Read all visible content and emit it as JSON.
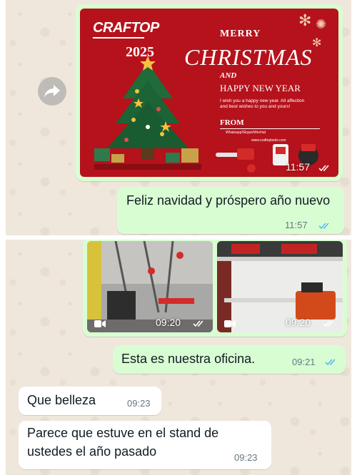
{
  "card": {
    "brand": "CRAFTOP",
    "year": "2025",
    "merry": "MERRY",
    "christmas": "CHRISTMAS",
    "and": "AND",
    "happy_new_year": "HAPPY NEW YEAR",
    "wish": "I wish you a happy new year. All affection and best wishes to you and yours!",
    "from": "FROM",
    "sender": "Whatsapp/Skype/Wechat",
    "website": "www.craftoptools.com",
    "time": "11:57"
  },
  "messages_top": [
    {
      "text": "Feliz navidad y próspero año nuevo",
      "time": "11:57"
    }
  ],
  "videos": [
    {
      "time": "09:20"
    },
    {
      "time": "09:20"
    }
  ],
  "messages_bottom": [
    {
      "text": "Esta es nuestra oficina.",
      "time": "09:21",
      "direction": "out"
    },
    {
      "text": "Que belleza",
      "time": "09:23",
      "direction": "in"
    },
    {
      "text": "Parece que estuve en el stand de ustedes el año pasado",
      "time": "09:23",
      "direction": "in"
    }
  ],
  "colors": {
    "outgoing_bubble": "#d9fdd3",
    "incoming_bubble": "#ffffff",
    "read_ticks": "#53bdeb",
    "chat_background": "#efe7dc",
    "card_red": "#b5121b"
  },
  "icons": {
    "forward": "forward-arrow-icon",
    "video": "video-camera-icon",
    "read": "double-check-icon"
  }
}
